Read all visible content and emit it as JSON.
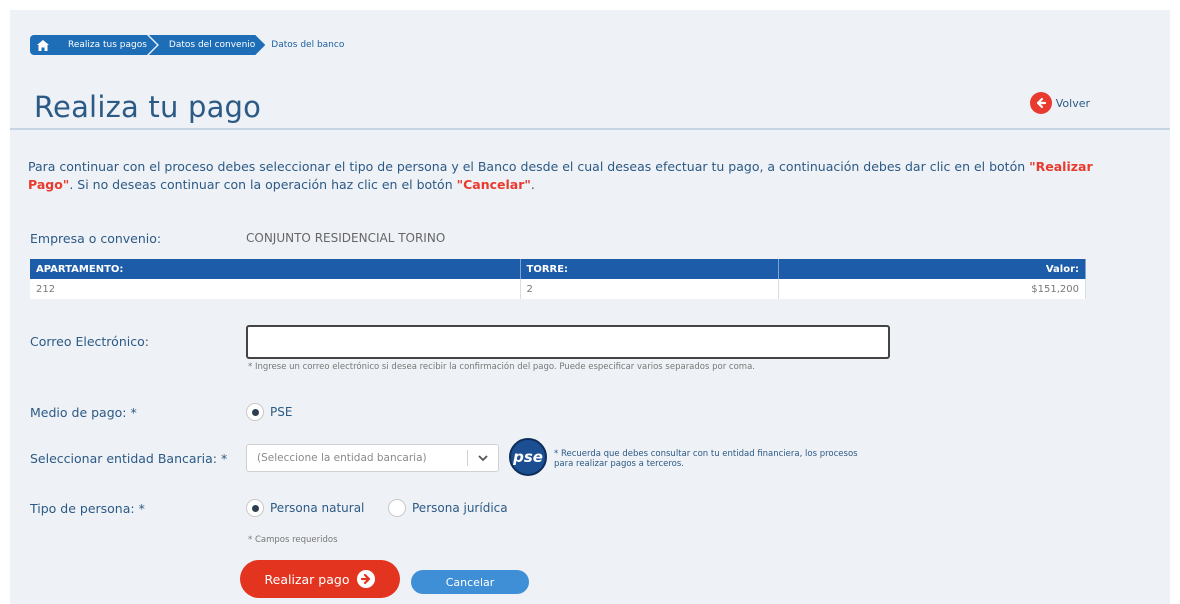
{
  "breadcrumb": {
    "items": [
      "Realiza tus pagos",
      "Datos del convenio",
      "Datos del banco"
    ]
  },
  "header": {
    "title": "Realiza tu pago",
    "back_label": "Volver"
  },
  "intro": {
    "part1": "Para continuar con el proceso debes seleccionar el tipo de persona y el Banco desde el cual deseas efectuar tu pago, a continuación debes dar clic en el botón ",
    "pay_word": "\"Realizar Pago\"",
    "part2": ". Si no deseas continuar con la operación haz clic en el botón ",
    "cancel_word": "\"Cancelar\"",
    "part3": "."
  },
  "company": {
    "label": "Empresa o convenio:",
    "value": "CONJUNTO RESIDENCIAL TORINO"
  },
  "table": {
    "headers": [
      "APARTAMENTO:",
      "TORRE:",
      "Valor:"
    ],
    "row": [
      "212",
      "2",
      "$151,200"
    ]
  },
  "email": {
    "label": "Correo Electrónico:",
    "value": "",
    "hint": "* Ingrese un correo electrónico si desea recibir la confirmación del pago. Puede especificar varios separados por coma."
  },
  "payment_method": {
    "label": "Medio de pago: *",
    "option": "PSE"
  },
  "bank": {
    "label": "Seleccionar entidad Bancaria: *",
    "placeholder": "(Seleccione la entidad bancaria)",
    "pse_logo": "pse",
    "note": "* Recuerda que debes consultar con tu entidad financiera,   los procesos para realizar pagos a terceros."
  },
  "person_type": {
    "label": "Tipo de persona: *",
    "options": [
      "Persona natural",
      "Persona jurídica"
    ],
    "selected": 0
  },
  "required_note": "* Campos requeridos",
  "buttons": {
    "pay": "Realizar pago",
    "cancel": "Cancelar"
  },
  "colors": {
    "primary_blue": "#1d5ca8",
    "accent_red": "#e3341f",
    "title_blue": "#2c5a86"
  }
}
